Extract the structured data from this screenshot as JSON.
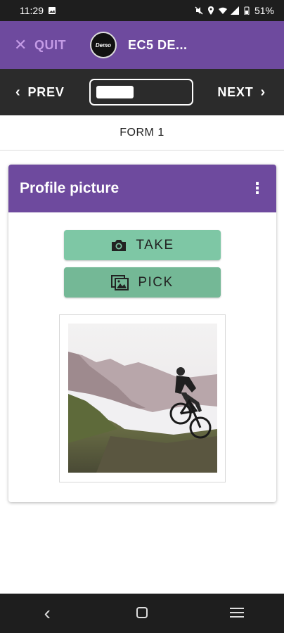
{
  "status_bar": {
    "time": "11:29",
    "battery": "51%"
  },
  "top_bar": {
    "quit_label": "QUIT",
    "logo_text": "Demo",
    "project_title": "EC5 DE..."
  },
  "nav_bar": {
    "prev_label": "PREV",
    "next_label": "NEXT",
    "progress_fraction": 0.4
  },
  "form": {
    "title": "FORM 1"
  },
  "question": {
    "title": "Profile picture",
    "take_label": "TAKE",
    "pick_label": "PICK"
  },
  "colors": {
    "brand_purple": "#6e4a9e",
    "quit_text": "#c49be6",
    "button_green": "#7ec7a5",
    "nav_dark": "#2b2b2b"
  }
}
